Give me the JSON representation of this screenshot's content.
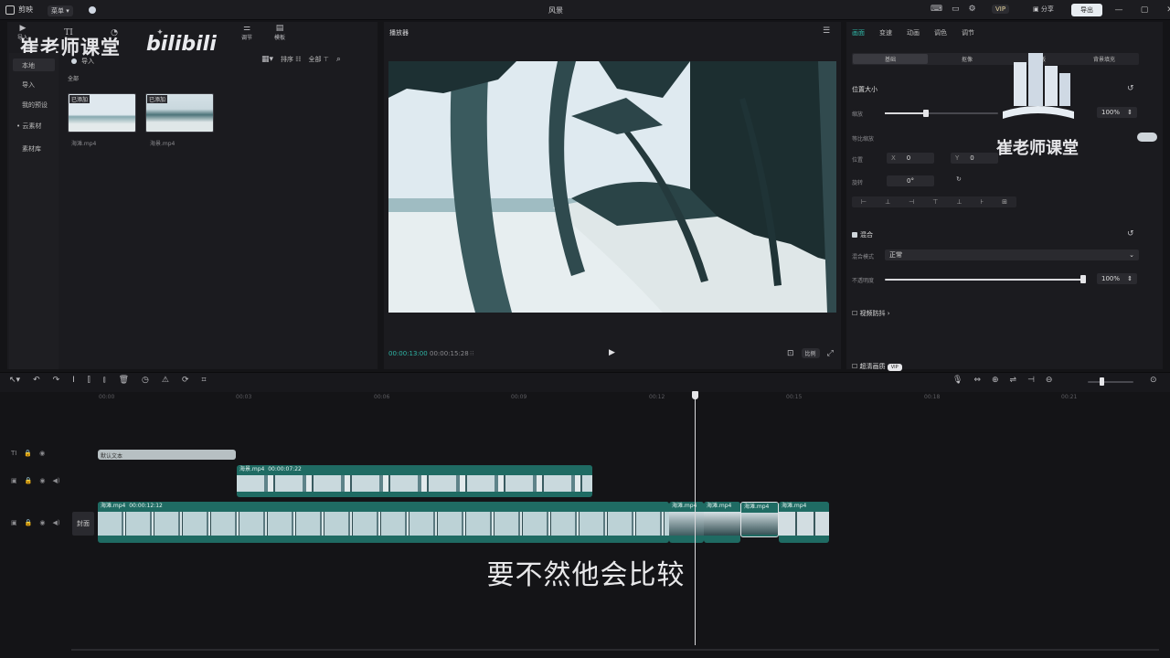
{
  "app": {
    "logo_text": "剪映",
    "title": "风景",
    "layout_label": "菜单",
    "header_badges": [
      "VIP"
    ],
    "right_pills": [
      "导出"
    ]
  },
  "watermark": {
    "left": "崔老师课堂",
    "bilibili": "bilibili",
    "right": "崔老师课堂"
  },
  "toolbar": {
    "items": [
      {
        "label": "导入",
        "icon": "media-icon"
      },
      {
        "label": "TI",
        "icon": "text-icon"
      },
      {
        "label": "贴纸",
        "icon": "sticker-icon"
      },
      {
        "label": "特效",
        "icon": "effects-icon"
      },
      {
        "label": "调节",
        "icon": "adjust-icon"
      },
      {
        "label": "模板",
        "icon": "template-icon"
      }
    ]
  },
  "media": {
    "sidebar": [
      "本地",
      "导入",
      "我的预设",
      "云素材",
      "素材库"
    ],
    "import_label": "导入",
    "all_label": "全部",
    "sort_label": "排序",
    "filter_label": "全部",
    "thumbs": [
      {
        "badge": "已添加",
        "name": "海滩.mp4"
      },
      {
        "badge": "已添加",
        "name": "海景.mp4"
      }
    ]
  },
  "player": {
    "title": "播放器",
    "time_current": "00:00:13:00",
    "time_total": "00:00:15:28",
    "ratio_label": "比例"
  },
  "inspector": {
    "tabs": [
      "画面",
      "变速",
      "动画",
      "调色",
      "调节"
    ],
    "subtabs": [
      "基础",
      "抠像",
      "蒙版",
      "背景填充"
    ],
    "position_size": "位置大小",
    "scale_label": "缩放",
    "scale_value": "100%",
    "uniform_label": "等比缩放",
    "position_label": "位置",
    "x_label": "X",
    "x_value": "0",
    "y_label": "Y",
    "y_value": "0",
    "rotate_label": "旋转",
    "rotate_value": "0°",
    "blend_label": "混合",
    "blend_mode_label": "混合模式",
    "blend_mode_value": "正常",
    "opacity_label": "不透明度",
    "opacity_value": "100%",
    "stabilize_label": "视频防抖",
    "superres_label": "超清画质",
    "superres_badge": "VIP"
  },
  "timeline": {
    "ruler": [
      "00:00",
      "00:03",
      "00:06",
      "00:09",
      "00:12",
      "00:15",
      "00:18",
      "00:21"
    ],
    "text_clip": "默认文本",
    "overlay_clip": {
      "name": "海景.mp4",
      "duration": "00:00:07:22"
    },
    "main_clip": {
      "name": "海滩.mp4",
      "duration": "00:00:12:12"
    },
    "small_clips": [
      "海滩.mp4",
      "海滩.mp4",
      "海滩.mp4",
      "海滩.mp4"
    ],
    "cover_label": "封面",
    "playhead_fraction": 0.76
  },
  "subtitle": "要不然他会比较"
}
